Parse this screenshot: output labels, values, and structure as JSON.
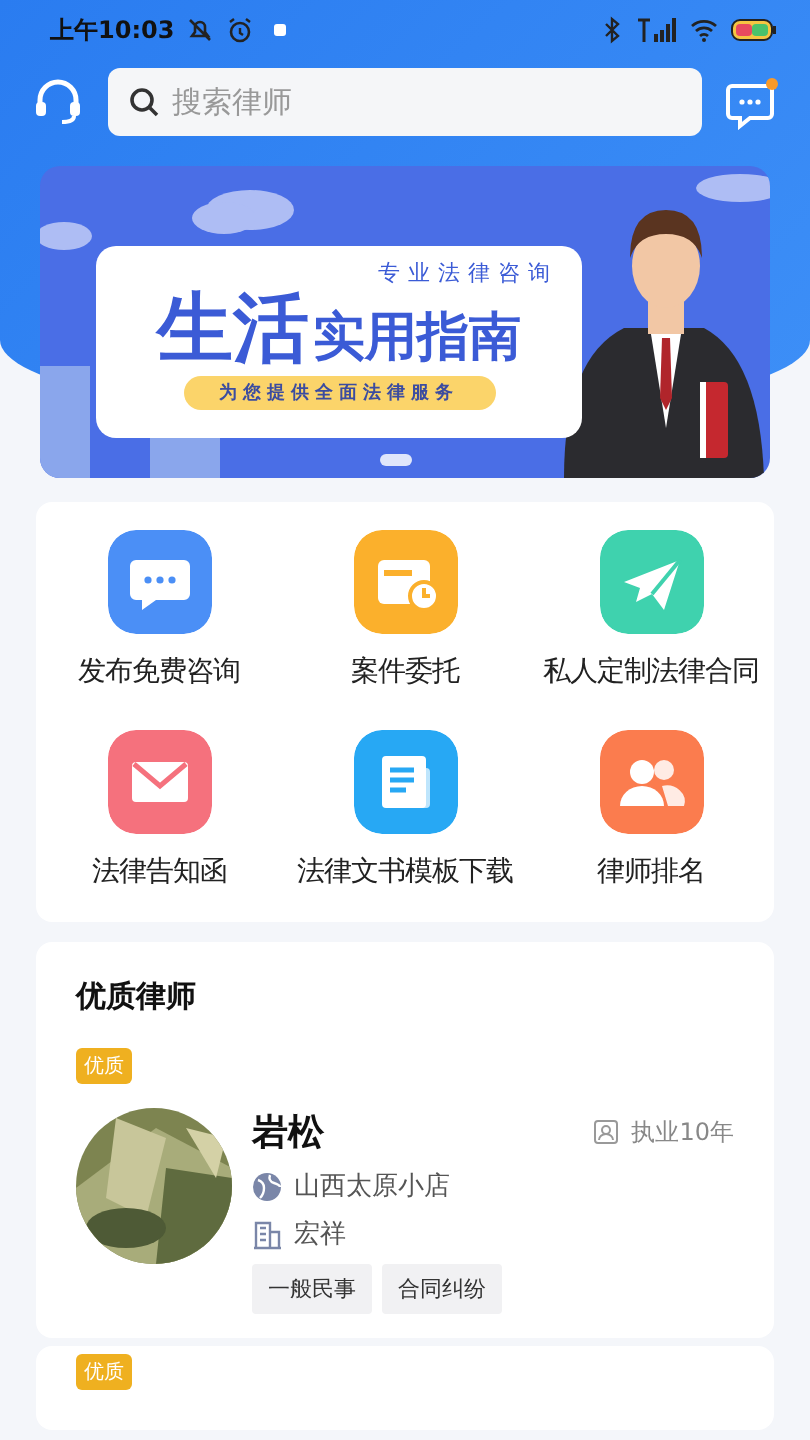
{
  "status_bar": {
    "time": "上午10:03"
  },
  "search": {
    "placeholder": "搜索律师"
  },
  "message_button": {
    "unread": true
  },
  "banner": {
    "tagline": "专业法律咨询",
    "title_large": "生活",
    "title": "实用指南",
    "subtitle": "为您提供全面法律服务"
  },
  "services": [
    {
      "label": "发布免费咨询",
      "kind": "chat",
      "color": "#4b8ff6"
    },
    {
      "label": "案件委托",
      "kind": "wallet",
      "color": "#fbb02c"
    },
    {
      "label": "私人定制法律合同",
      "kind": "plane",
      "color": "#3fd2ae"
    },
    {
      "label": "法律告知函",
      "kind": "mail",
      "color": "#f5717d"
    },
    {
      "label": "法律文书模板下载",
      "kind": "doc",
      "color": "#27a8f4"
    },
    {
      "label": "律师排名",
      "kind": "people",
      "color": "#fb7c4e"
    }
  ],
  "lawyers_section": {
    "title": "优质律师",
    "lawyers": [
      {
        "badge": "优质",
        "name": "岩松",
        "experience": "执业10年",
        "location": "山西太原小店",
        "firm": "宏祥",
        "tags": [
          "一般民事",
          "合同纠纷"
        ]
      },
      {
        "badge": "优质"
      }
    ]
  }
}
